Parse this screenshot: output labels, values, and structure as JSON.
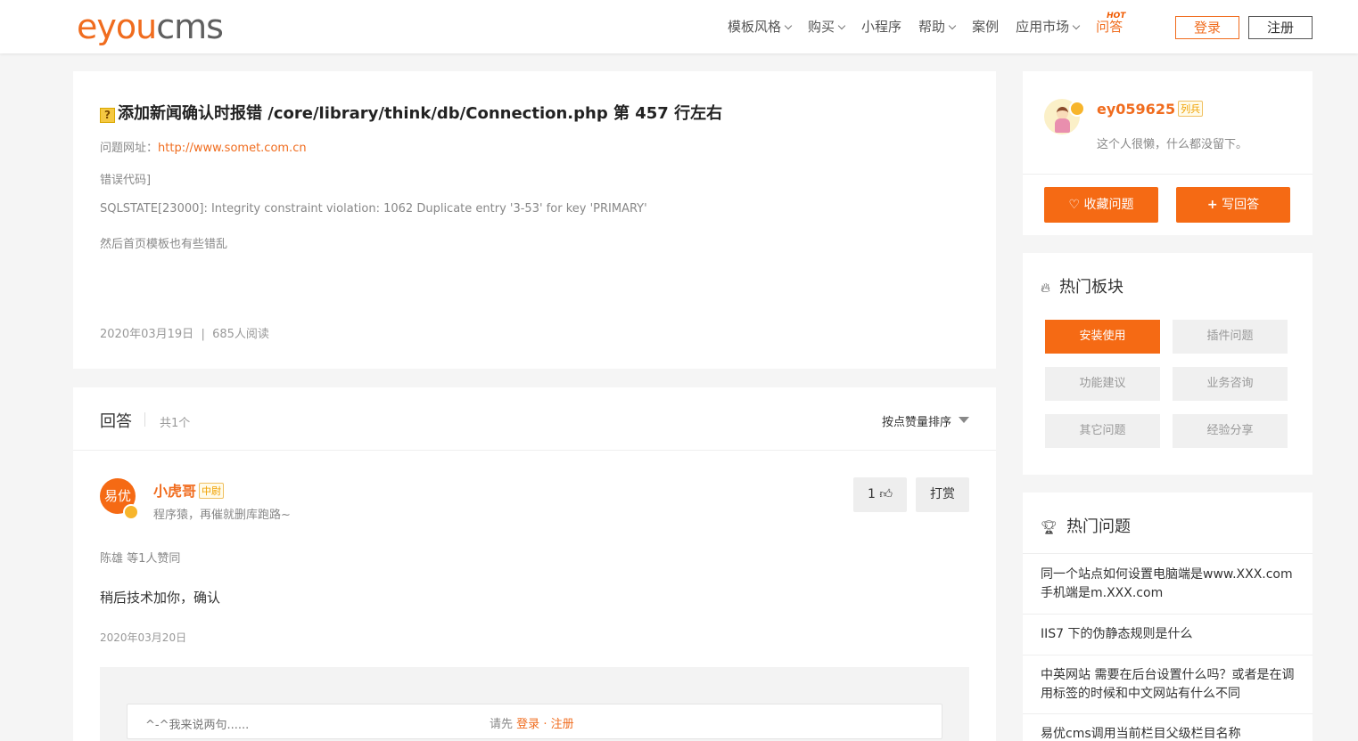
{
  "header": {
    "logo": {
      "part1": "eyou",
      "part2": "cms"
    },
    "nav": [
      {
        "label": "模板风格",
        "dropdown": true
      },
      {
        "label": "购买",
        "dropdown": true
      },
      {
        "label": "小程序",
        "dropdown": false
      },
      {
        "label": "帮助",
        "dropdown": true
      },
      {
        "label": "案例",
        "dropdown": false
      },
      {
        "label": "应用市场",
        "dropdown": true
      },
      {
        "label": "问答",
        "dropdown": false,
        "badge": "HOT"
      }
    ],
    "login": "登录",
    "register": "注册"
  },
  "question": {
    "title": "添加新闻确认时报错 /core/library/think/db/Connection.php 第 457 行左右",
    "url_label": "问题网址：",
    "url": "http://www.somet.com.cn",
    "line2": "错误代码]",
    "line3": "SQLSTATE[23000]: Integrity constraint violation: 1062 Duplicate entry '3-53' for key 'PRIMARY'",
    "line4": "然后首页模板也有些错乱",
    "date": "2020年03月19日",
    "meta_sep": "|",
    "views": "685人阅读"
  },
  "answers": {
    "title": "回答",
    "count": "共1个",
    "sort": "按点赞量排序",
    "items": [
      {
        "avatar_text": "易优",
        "name": "小虎哥",
        "rank": "中尉",
        "sign": "程序猿，再催就删库跑路~",
        "likes": "1",
        "reward": "打赏",
        "voters": "陈雄 等1人赞同",
        "body": "稍后技术加你，确认",
        "date": "2020年03月20日"
      }
    ],
    "comment": {
      "placeholder": "^-^我来说两句......",
      "prompt": "请先",
      "login": "登录",
      "dot": "·",
      "register": "注册"
    }
  },
  "sidebar": {
    "user": {
      "name": "ey059625",
      "rank": "列兵",
      "sign": "这个人很懒，什么都没留下。",
      "fav_button": "收藏问题",
      "write_button": "写回答"
    },
    "boards": {
      "title": "热门板块",
      "items": [
        "安装使用",
        "插件问题",
        "功能建议",
        "业务咨询",
        "其它问题",
        "经验分享"
      ]
    },
    "hot": {
      "title": "热门问题",
      "items": [
        "同一个站点如何设置电脑端是www.XXX.com手机端是m.XXX.com",
        "IIS7 下的伪静态规则是什么",
        "中英网站 需要在后台设置什么吗？或者是在调用标签的时候和中文网站有什么不同",
        "易优cms调用当前栏目父级栏目名称"
      ]
    }
  },
  "colors": {
    "accent": "#f56a14",
    "background": "#f5f5f5"
  }
}
